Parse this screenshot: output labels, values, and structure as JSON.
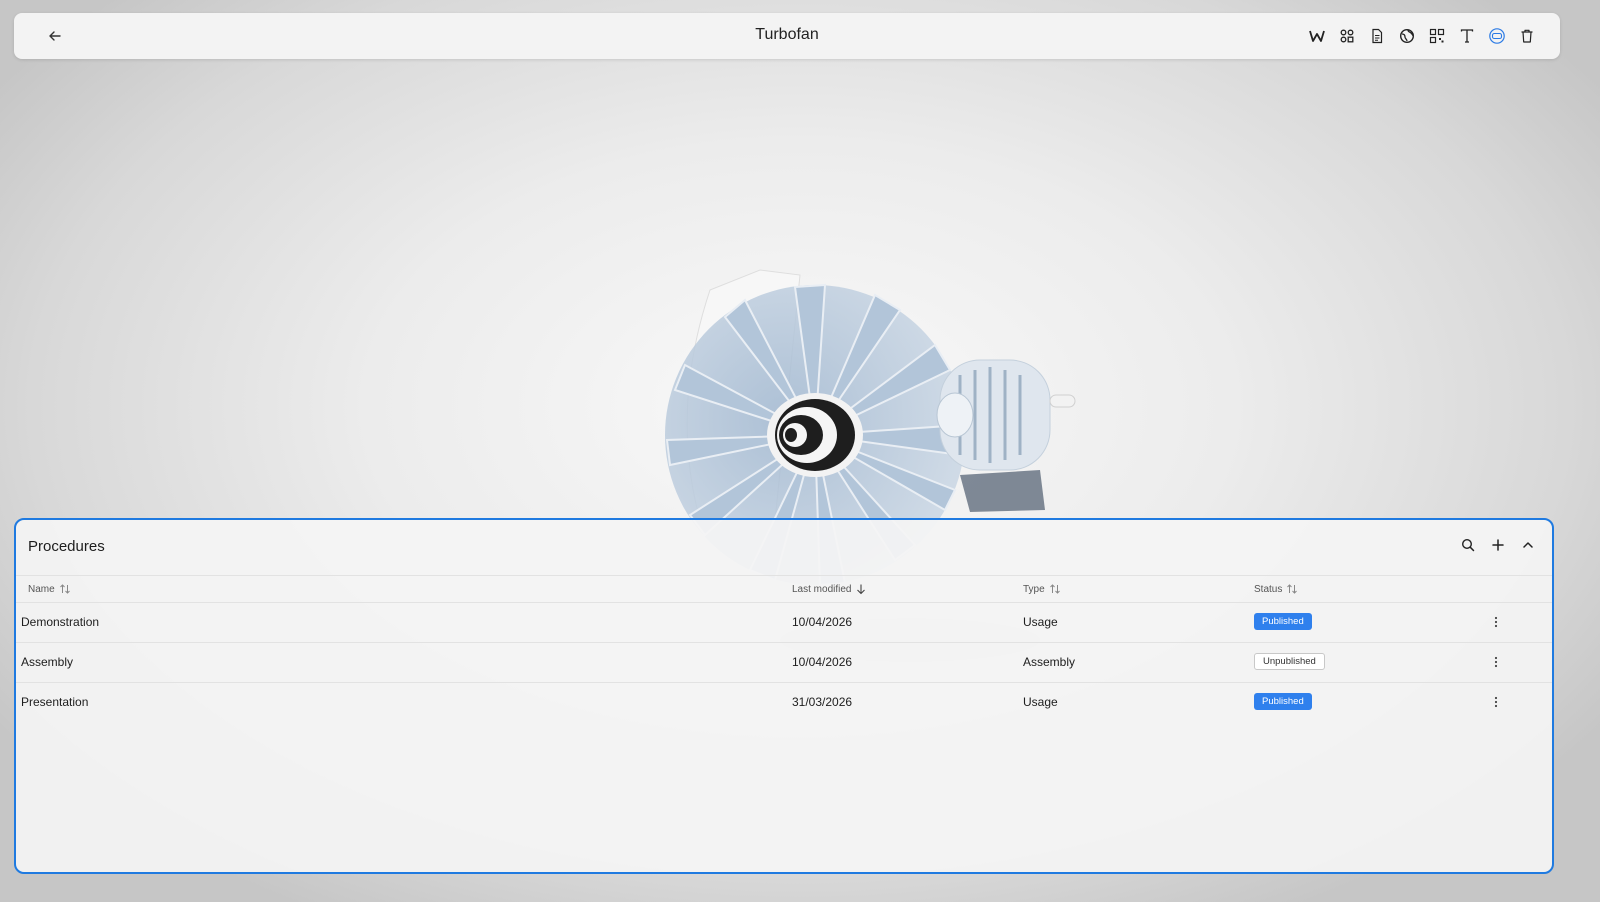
{
  "header": {
    "title": "Turbofan",
    "tools": [
      {
        "name": "logo-tool-icon"
      },
      {
        "name": "components-icon"
      },
      {
        "name": "document-icon"
      },
      {
        "name": "globe-icon"
      },
      {
        "name": "qr-code-icon"
      },
      {
        "name": "text-icon"
      },
      {
        "name": "vr-headset-icon",
        "active": true
      },
      {
        "name": "trash-icon"
      }
    ]
  },
  "procedures": {
    "title": "Procedures",
    "columns": {
      "name": "Name",
      "last_modified": "Last modified",
      "type": "Type",
      "status": "Status"
    },
    "rows": [
      {
        "name": "Demonstration",
        "last_modified": "10/04/2026",
        "type": "Usage",
        "status": "Published"
      },
      {
        "name": "Assembly",
        "last_modified": "10/04/2026",
        "type": "Assembly",
        "status": "Unpublished"
      },
      {
        "name": "Presentation",
        "last_modified": "31/03/2026",
        "type": "Usage",
        "status": "Published"
      }
    ]
  },
  "colors": {
    "accent": "#1f7ae0",
    "published_badge": "#2f80ed"
  }
}
